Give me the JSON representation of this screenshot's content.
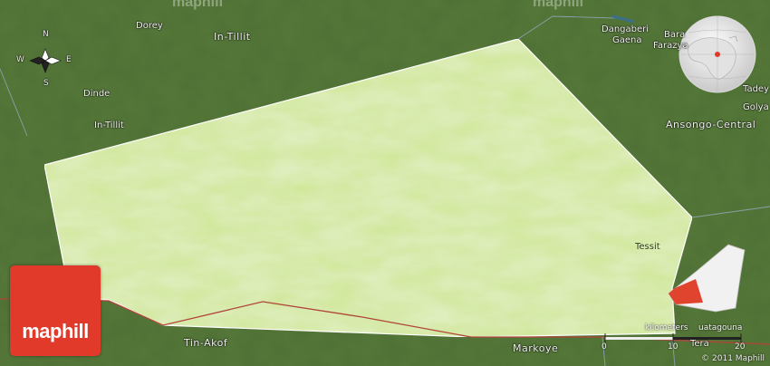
{
  "map": {
    "watermarks": [
      "maphill",
      "maphill"
    ],
    "places": [
      {
        "id": "dorey",
        "label": "Dorey"
      },
      {
        "id": "in-tillit-region",
        "label": "In-Tillit"
      },
      {
        "id": "dinde",
        "label": "Dinde"
      },
      {
        "id": "in-tillit-town",
        "label": "In-Tillit"
      },
      {
        "id": "dangaberi",
        "label": "Dangaberi"
      },
      {
        "id": "gaena",
        "label": "Gaena"
      },
      {
        "id": "bara",
        "label": "Bara"
      },
      {
        "id": "farazya",
        "label": "Farazya"
      },
      {
        "id": "tadey",
        "label": "Tadey"
      },
      {
        "id": "golya",
        "label": "Golya"
      },
      {
        "id": "ansongo-central",
        "label": "Ansongo-Central"
      },
      {
        "id": "tessit",
        "label": "Tessit"
      },
      {
        "id": "tin-akof",
        "label": "Tin-Akof"
      },
      {
        "id": "markoye",
        "label": "Markoye"
      },
      {
        "id": "tera",
        "label": "Tera"
      }
    ],
    "compass": {
      "north": "N",
      "south": "S",
      "east": "E",
      "west": "W"
    },
    "scale": {
      "unit": "kilometers",
      "ticks": [
        "0",
        "10",
        "20"
      ],
      "overlap_label": "uatagouna"
    },
    "logo": "maphill",
    "copyright": "© 2011 Maphill",
    "colors": {
      "region_fill": "#cfe694",
      "region_outline": "#ffffff",
      "surround": "#4f6f36",
      "logo": "#e23a2a",
      "border_red": "#b0443a"
    }
  }
}
